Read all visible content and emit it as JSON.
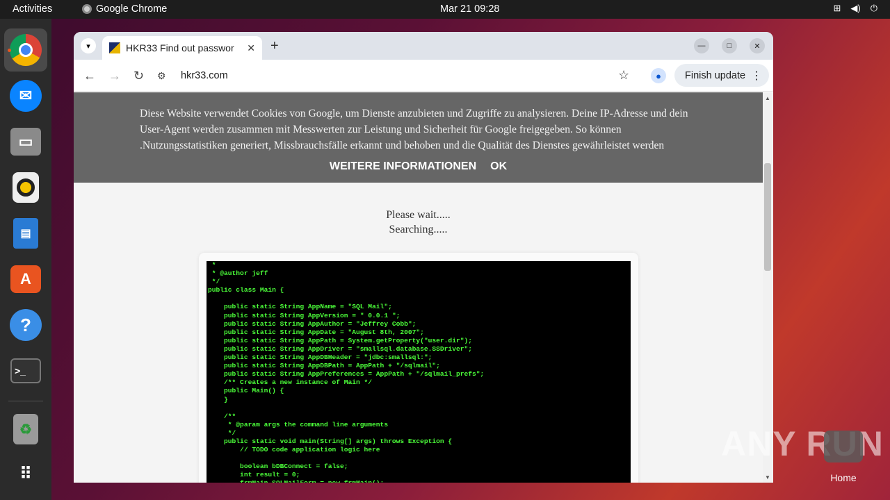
{
  "topbar": {
    "activities": "Activities",
    "app_name": "Google Chrome",
    "clock": "Mar 21  09:28",
    "tray_icons": [
      "network-icon",
      "volume-icon",
      "power-icon"
    ]
  },
  "dock": {
    "items": [
      {
        "name": "chrome",
        "icon": "chrome-icon",
        "color": "#db4437"
      },
      {
        "name": "thunderbird",
        "icon": "thunderbird-icon",
        "color": "#0a84ff"
      },
      {
        "name": "files",
        "icon": "folder-icon",
        "color": "#8a8a8a"
      },
      {
        "name": "rhythmbox",
        "icon": "rhythmbox-icon",
        "color": "#f5c400"
      },
      {
        "name": "writer",
        "icon": "writer-icon",
        "color": "#2a7bd4"
      },
      {
        "name": "app-center",
        "icon": "app-store-icon",
        "color": "#e95420"
      },
      {
        "name": "help",
        "icon": "help-icon",
        "color": "#3a8ee6"
      },
      {
        "name": "terminal",
        "icon": "terminal-icon",
        "color": "#333333"
      },
      {
        "name": "trash",
        "icon": "trash-icon",
        "color": "#9a9a9a"
      },
      {
        "name": "show-apps",
        "icon": "grid-icon",
        "color": "#2b2b2b"
      }
    ]
  },
  "browser": {
    "tab_title": "HKR33 Find out passwor",
    "url": "hkr33.com",
    "finish_update": "Finish update"
  },
  "cookie_banner": {
    "text": "Diese Website verwendet Cookies von Google, um Dienste anzubieten und Zugriffe zu analysieren. Deine IP-Adresse und dein User-Agent werden zusammen mit Messwerten zur Leistung und Sicherheit für Google freigegeben. So können .Nutzungsstatistiken generiert, Missbrauchsfälle erkannt und behoben und die Qualität des Dienstes gewährleistet werden",
    "more_info": "WEITERE INFORMATIONEN",
    "ok": "OK"
  },
  "page": {
    "wait_line1": "Please wait.....",
    "wait_line2": "Searching.....",
    "terminal_text": " *\n * @author jeff\n */\npublic class Main {\n\n    public static String AppName = \"SQL Mail\";\n    public static String AppVersion = \" 0.0.1 \";\n    public static String AppAuthor = \"Jeffrey Cobb\";\n    public static String AppDate = \"August 8th, 2007\";\n    public static String AppPath = System.getProperty(\"user.dir\");\n    public static String AppDriver = \"smallsql.database.SSDriver\";\n    public static String AppDBHeader = \"jdbc:smallsql:\";\n    public static String AppDBPath = AppPath + \"/sqlmail\";\n    public static String AppPreferences = AppPath + \"/sqlmail_prefs\";\n    /** Creates a new instance of Main */\n    public Main() {\n    }\n\n    /**\n     * @param args the command line arguments\n     */\n    public static void main(String[] args) throws Exception {\n        // TODO code application logic here\n\n        boolean bDBConnect = false;\n        int result = 0;\n        frmMain SQLMailForm = new frmMain();"
  },
  "watermark": "ANY RUN",
  "desktop": {
    "home_label": "Home"
  }
}
